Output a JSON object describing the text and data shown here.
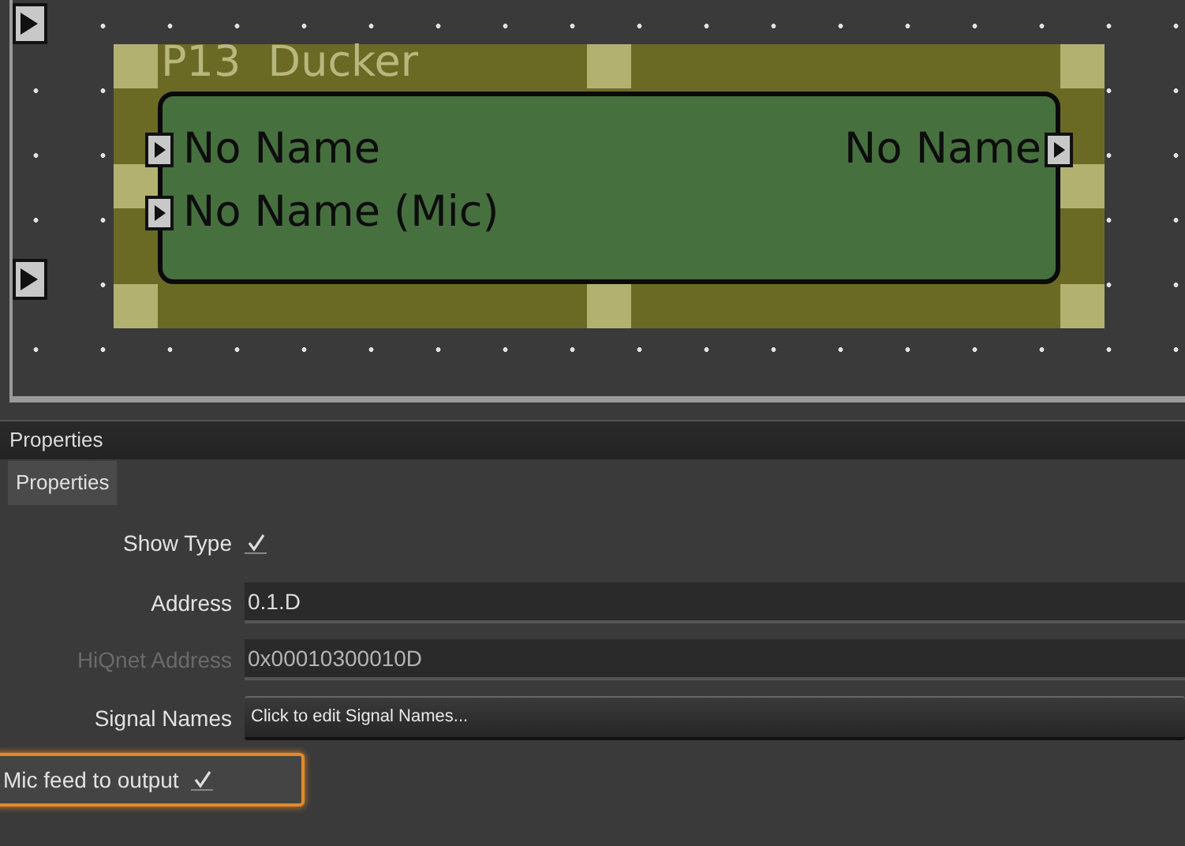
{
  "canvas": {
    "block": {
      "title": "P13  Ducker",
      "inputs": [
        "No Name",
        "No Name (Mic)"
      ],
      "outputs": [
        "No Name"
      ]
    }
  },
  "panel": {
    "title": "Properties",
    "tabs": [
      {
        "label": "Properties",
        "selected": true
      }
    ],
    "fields": [
      {
        "kind": "checkbox",
        "label": "Show Type",
        "checked": true,
        "focused": false
      },
      {
        "kind": "text",
        "label": "Address",
        "value": "0.1.D",
        "disabled": false
      },
      {
        "kind": "text",
        "label": "HiQnet Address",
        "value": "0x00010300010D",
        "disabled": true
      },
      {
        "kind": "button",
        "label": "Signal Names",
        "value": "Click to edit Signal Names..."
      },
      {
        "kind": "checkbox",
        "label": "Mic feed to output",
        "checked": true,
        "focused": true
      }
    ]
  }
}
